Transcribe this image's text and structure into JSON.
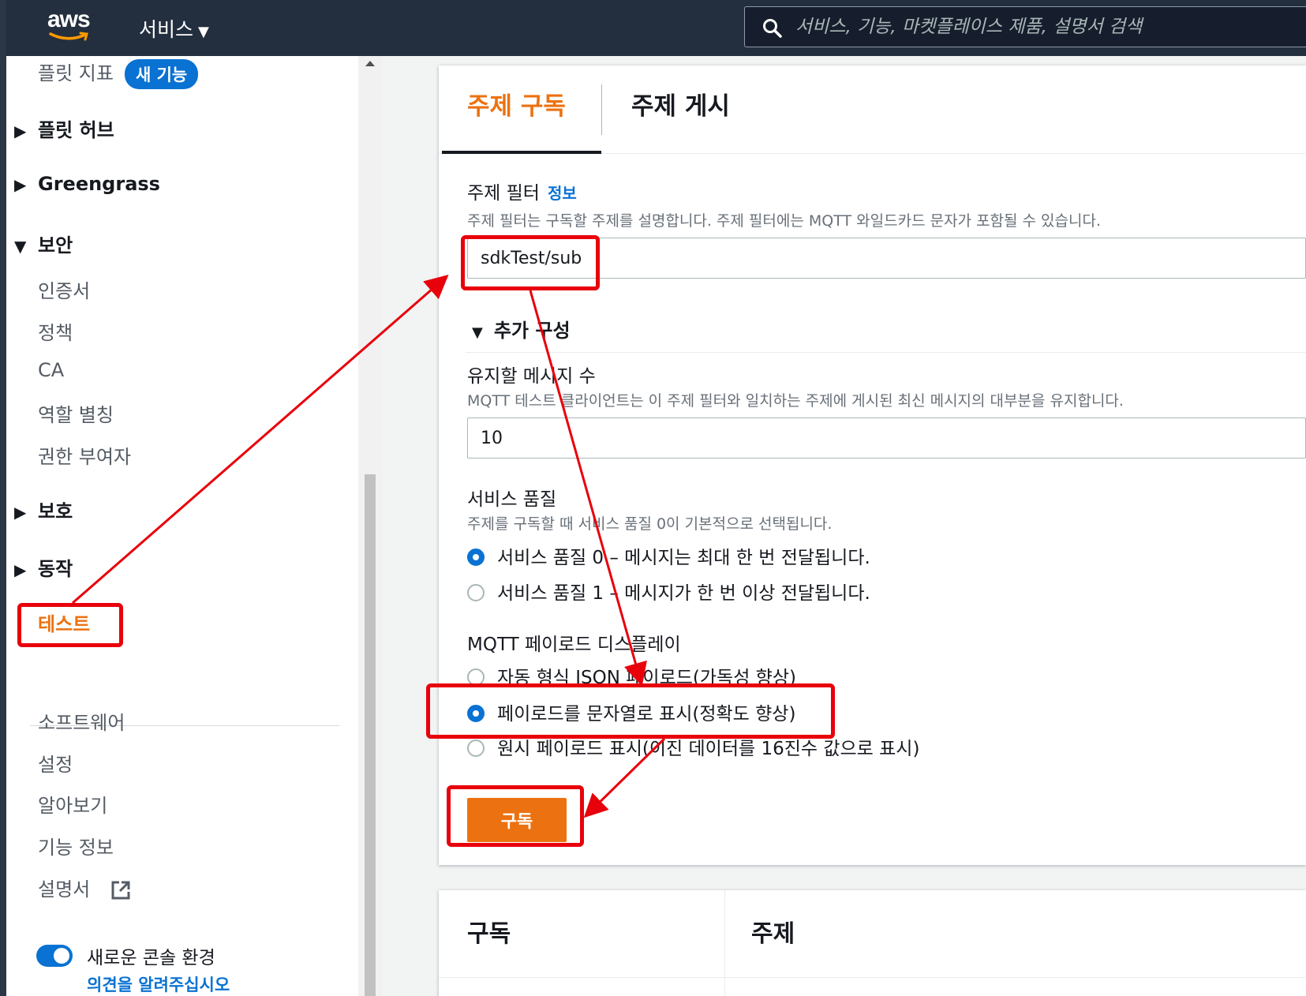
{
  "topnav": {
    "logo_text": "aws",
    "services_label": "서비스",
    "search_placeholder": "서비스, 기능, 마켓플레이스 제품, 설명서 검색"
  },
  "sidebar": {
    "fleet_metrics": "플릿 지표",
    "new_badge": "새 기능",
    "fleet_hub": "플릿 허브",
    "greengrass": "Greengrass",
    "security": "보안",
    "security_items": [
      "인증서",
      "정책",
      "CA",
      "역할 별칭",
      "권한 부여자"
    ],
    "defend": "보호",
    "act": "동작",
    "test": "테스트",
    "bottom_items": [
      "소프트웨어",
      "설정",
      "알아보기",
      "기능 정보",
      "설명서"
    ],
    "new_console_label": "새로운 콘솔 환경",
    "feedback_link": "의견을 알려주십시오"
  },
  "tabs": {
    "subscribe": "주제 구독",
    "publish": "주제 게시"
  },
  "form": {
    "topic_filter_label": "주제 필터",
    "info_link": "정보",
    "topic_filter_desc": "주제 필터는 구독할 주제를 설명합니다. 주제 필터에는 MQTT 와일드카드 문자가 포함될 수 있습니다.",
    "topic_filter_value": "sdkTest/sub",
    "additional_config": "추가 구성",
    "retain_label": "유지할 메시지 수",
    "retain_desc": "MQTT 테스트 클라이언트는 이 주제 필터와 일치하는 주제에 게시된 최신 메시지의 대부분을 유지합니다.",
    "retain_value": "10",
    "qos_label": "서비스 품질",
    "qos_desc": "주제를 구독할 때 서비스 품질 0이 기본적으로 선택됩니다.",
    "qos_options": [
      "서비스 품질 0 – 메시지는 최대 한 번 전달됩니다.",
      "서비스 품질 1 – 메시지가 한 번 이상 전달됩니다."
    ],
    "qos_selected": 0,
    "payload_label": "MQTT 페이로드 디스플레이",
    "payload_options": [
      "자동 형식 JSON 페이로드(가독성 향상)",
      "페이로드를 문자열로 표시(정확도 향상)",
      "원시 페이로드 표시(이진 데이터를 16진수 값으로 표시)"
    ],
    "payload_selected": 1,
    "subscribe_button": "구독"
  },
  "table": {
    "col_subscriptions": "구독",
    "col_topic": "주제"
  },
  "colors": {
    "accent": "#ec7211",
    "link": "#0972d3",
    "annotation": "#e8000b",
    "nav_bg": "#232f3e"
  }
}
